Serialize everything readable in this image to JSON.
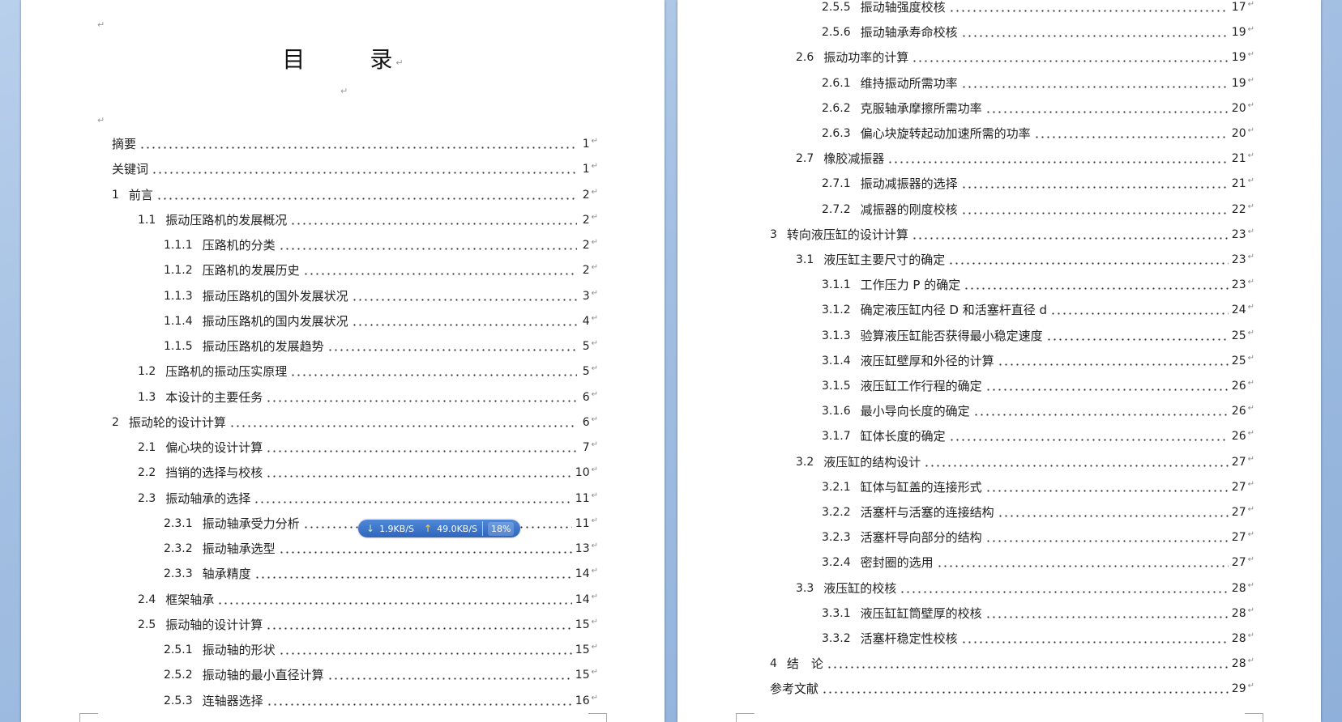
{
  "left_page": {
    "title": "目　录",
    "entries": [
      {
        "num": "",
        "label": "摘要",
        "page": "1"
      },
      {
        "num": "",
        "label": "关键词",
        "page": "1"
      },
      {
        "num": "1",
        "label": "前言",
        "page": "2"
      },
      {
        "num": "1.1",
        "label": "振动压路机的发展概况",
        "page": "2"
      },
      {
        "num": "1.1.1",
        "label": "压路机的分类",
        "page": "2"
      },
      {
        "num": "1.1.2",
        "label": "压路机的发展历史",
        "page": "2"
      },
      {
        "num": "1.1.3",
        "label": "振动压路机的国外发展状况",
        "page": "3"
      },
      {
        "num": "1.1.4",
        "label": "振动压路机的国内发展状况",
        "page": "4"
      },
      {
        "num": "1.1.5",
        "label": "振动压路机的发展趋势",
        "page": "5"
      },
      {
        "num": "1.2",
        "label": "压路机的振动压实原理",
        "page": "5"
      },
      {
        "num": "1.3",
        "label": "本设计的主要任务",
        "page": "6"
      },
      {
        "num": "2",
        "label": "振动轮的设计计算",
        "page": "6"
      },
      {
        "num": "2.1",
        "label": "偏心块的设计计算",
        "page": "7"
      },
      {
        "num": "2.2",
        "label": "挡销的选择与校核",
        "page": "10"
      },
      {
        "num": "2.3",
        "label": "振动轴承的选择",
        "page": "11"
      },
      {
        "num": "2.3.1",
        "label": "振动轴承受力分析",
        "page": "11"
      },
      {
        "num": "2.3.2",
        "label": "振动轴承选型",
        "page": "13"
      },
      {
        "num": "2.3.3",
        "label": "轴承精度",
        "page": "14"
      },
      {
        "num": "2.4",
        "label": "框架轴承",
        "page": "14"
      },
      {
        "num": "2.5",
        "label": "振动轴的设计计算",
        "page": "15"
      },
      {
        "num": "2.5.1",
        "label": "振动轴的形状",
        "page": "15"
      },
      {
        "num": "2.5.2",
        "label": "振动轴的最小直径计算",
        "page": "15"
      },
      {
        "num": "2.5.3",
        "label": "连轴器选择",
        "page": "16"
      }
    ]
  },
  "right_page": {
    "entries": [
      {
        "num": "2.5.5",
        "label": "振动轴强度校核",
        "page": "17"
      },
      {
        "num": "2.5.6",
        "label": "振动轴承寿命校核",
        "page": "19"
      },
      {
        "num": "2.6",
        "label": "振动功率的计算",
        "page": "19"
      },
      {
        "num": "2.6.1",
        "label": "维持振动所需功率",
        "page": "19"
      },
      {
        "num": "2.6.2",
        "label": "克服轴承摩擦所需功率",
        "page": "20"
      },
      {
        "num": "2.6.3",
        "label": "偏心块旋转起动加速所需的功率",
        "page": "20"
      },
      {
        "num": "2.7",
        "label": "橡胶减振器",
        "page": "21"
      },
      {
        "num": "2.7.1",
        "label": "振动减振器的选择",
        "page": "21"
      },
      {
        "num": "2.7.2",
        "label": "减振器的刚度校核",
        "page": "22"
      },
      {
        "num": "3",
        "label": "转向液压缸的设计计算",
        "page": "23"
      },
      {
        "num": "3.1",
        "label": "液压缸主要尺寸的确定",
        "page": "23"
      },
      {
        "num": "3.1.1",
        "label": "工作压力 P 的确定",
        "page": "23"
      },
      {
        "num": "3.1.2",
        "label": "确定液压缸内径 D 和活塞杆直径 d",
        "page": "24"
      },
      {
        "num": "3.1.3",
        "label": "验算液压缸能否获得最小稳定速度",
        "page": "25"
      },
      {
        "num": "3.1.4",
        "label": "液压缸壁厚和外径的计算",
        "page": "25"
      },
      {
        "num": "3.1.5",
        "label": "液压缸工作行程的确定",
        "page": "26"
      },
      {
        "num": "3.1.6",
        "label": "最小导向长度的确定",
        "page": "26"
      },
      {
        "num": "3.1.7",
        "label": "缸体长度的确定",
        "page": "26"
      },
      {
        "num": "3.2",
        "label": "液压缸的结构设计",
        "page": "27"
      },
      {
        "num": "3.2.1",
        "label": "缸体与缸盖的连接形式",
        "page": "27"
      },
      {
        "num": "3.2.2",
        "label": "活塞杆与活塞的连接结构",
        "page": "27"
      },
      {
        "num": "3.2.3",
        "label": "活塞杆导向部分的结构",
        "page": "27"
      },
      {
        "num": "3.2.4",
        "label": "密封圈的选用",
        "page": "27"
      },
      {
        "num": "3.3",
        "label": "液压缸的校核",
        "page": "28"
      },
      {
        "num": "3.3.1",
        "label": "液压缸缸筒壁厚的校核",
        "page": "28"
      },
      {
        "num": "3.3.2",
        "label": "活塞杆稳定性校核",
        "page": "28"
      },
      {
        "num": "4",
        "label": "结　论",
        "page": "28"
      },
      {
        "num": "",
        "label": "参考文献",
        "page": "29"
      }
    ]
  },
  "paragraph_mark": "↵",
  "net_widget": {
    "download": "1.9KB/S",
    "upload": "49.0KB/S",
    "percent": "18%",
    "download_icon": "arrow-down-icon",
    "upload_icon": "arrow-up-icon"
  }
}
